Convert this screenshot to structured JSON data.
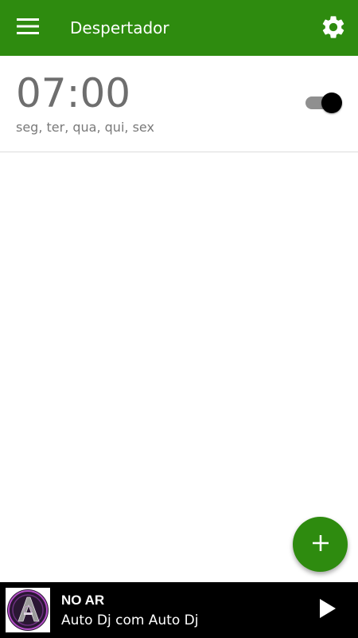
{
  "toolbar": {
    "title": "Despertador",
    "menu_icon": "hamburger-menu-icon",
    "settings_icon": "gear-icon",
    "background_color": "#2e8b0f"
  },
  "alarms": [
    {
      "time": "07:00",
      "days": "seg, ter, qua, qui, sex",
      "enabled": true
    }
  ],
  "fab": {
    "icon": "plus-icon",
    "color": "#2e8b0f"
  },
  "player": {
    "status": "NO AR",
    "track": "Auto Dj com Auto Dj",
    "play_icon": "play-icon",
    "cover_icon": "album-cover"
  }
}
